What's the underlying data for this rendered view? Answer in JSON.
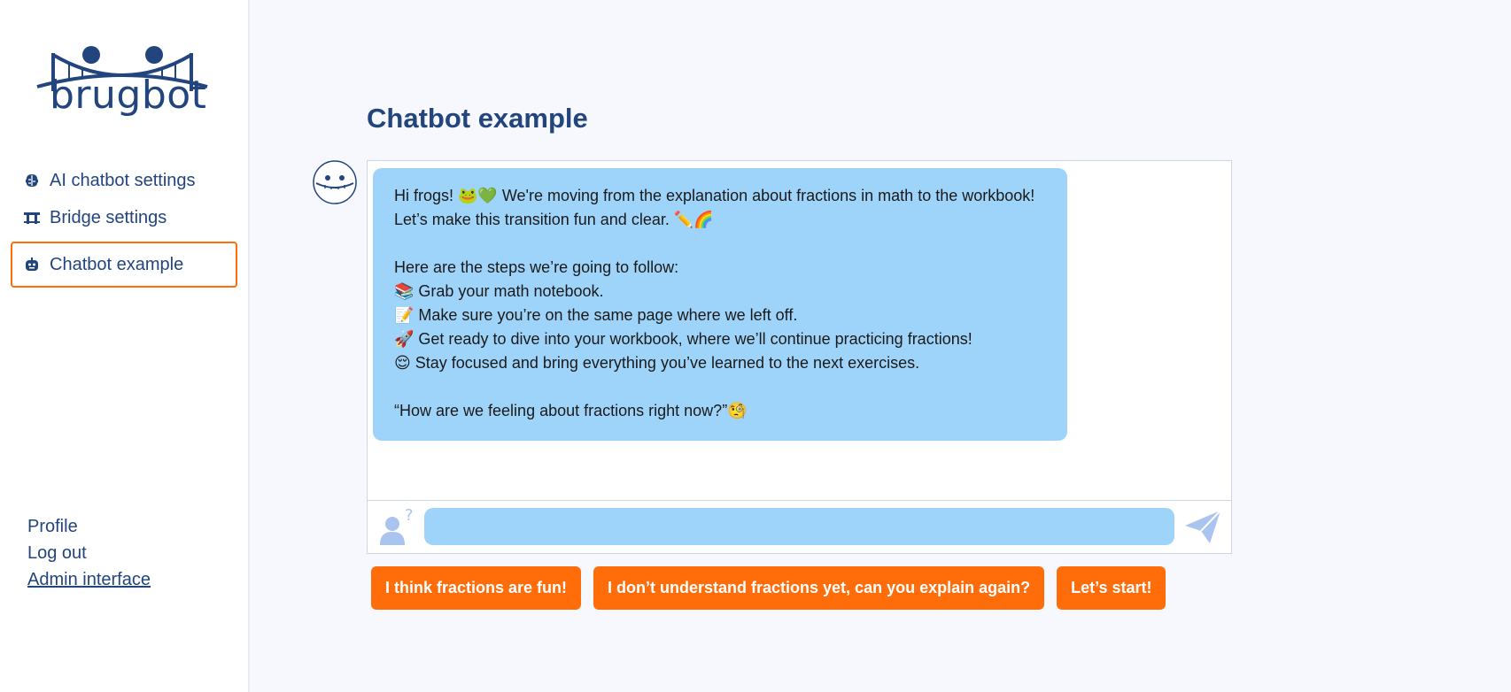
{
  "brand": {
    "name": "brugbot"
  },
  "sidebar": {
    "items": [
      {
        "label": "AI chatbot settings",
        "icon": "brain-icon"
      },
      {
        "label": "Bridge settings",
        "icon": "bridge-icon"
      },
      {
        "label": "Chatbot example",
        "icon": "robot-icon",
        "active": true
      }
    ],
    "links": {
      "profile": "Profile",
      "logout": "Log out",
      "admin": "Admin interface"
    }
  },
  "main": {
    "title": "Chatbot example",
    "message": {
      "line1": "Hi frogs! 🐸💚 We're moving from the explanation about fractions in math to the workbook! Let’s make this transition fun and clear. ✏️🌈",
      "intro": "Here are the steps we’re going to follow:",
      "step1": "📚 Grab your math notebook.",
      "step2": "📝 Make sure you’re on the same page where we left off.",
      "step3": "🚀 Get ready to dive into your workbook, where we’ll continue practicing fractions!",
      "step4": "😌 Stay focused and bring everything you’ve learned to the next exercises.",
      "question": "“How are we feeling about fractions right now?”🧐"
    },
    "input": {
      "value": "",
      "placeholder": ""
    },
    "suggestions": [
      "I think fractions are fun!",
      "I don’t understand fractions yet, can you explain again?",
      "Let’s start!"
    ]
  },
  "colors": {
    "accent": "#ff6d0a",
    "primary": "#22457e",
    "bubble": "#9fd4fa",
    "background": "#f6f8fd"
  }
}
